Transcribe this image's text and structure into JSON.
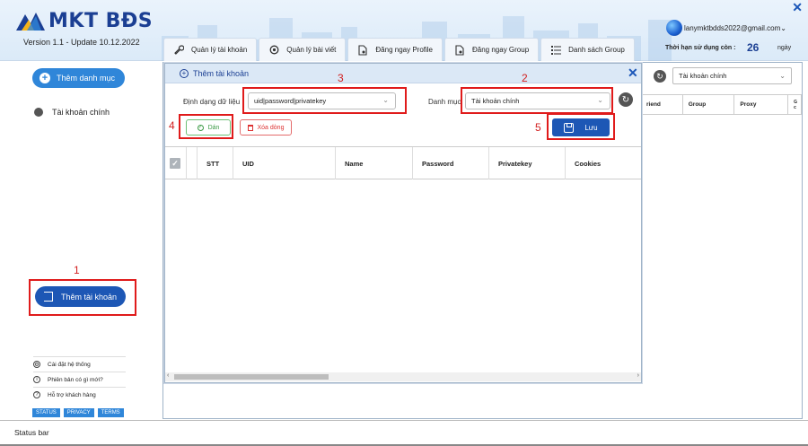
{
  "app": {
    "logo_text": "MKT BĐS",
    "version": "Version 1.1 - Update 10.12.2022",
    "close_symbol": "✕"
  },
  "user": {
    "email": "lanymktbdds2022@gmail.com",
    "remaining_label": "Thời hạn sử dụng còn :",
    "remaining_days": "26",
    "remaining_unit": "ngày"
  },
  "tabs": [
    {
      "label": "Quản lý tài khoản",
      "icon": "wrench-icon"
    },
    {
      "label": "Quản lý bài viết",
      "icon": "gear-eye-icon"
    },
    {
      "label": "Đăng ngay Profile",
      "icon": "document-icon"
    },
    {
      "label": "Đăng ngay Group",
      "icon": "document-icon"
    },
    {
      "label": "Danh sách Group",
      "icon": "list-icon"
    }
  ],
  "sidebar": {
    "add_category": "Thêm danh mục",
    "account_item": "Tài khoản chính",
    "add_account": "Thêm tài khoản",
    "links": [
      {
        "label": "Cài đặt hệ thống",
        "icon": "gear-icon"
      },
      {
        "label": "Phiên bản có gì mới?",
        "icon": "info-icon"
      },
      {
        "label": "Hỗ trợ khách hàng",
        "icon": "question-icon"
      }
    ],
    "badges": [
      "STATUS",
      "PRIVACY",
      "TERMS"
    ]
  },
  "main": {
    "category_select": "Tài khoản chính",
    "columns_visible": [
      "riend",
      "Group",
      "Proxy",
      "G c"
    ]
  },
  "dialog": {
    "title": "Thêm tài khoản",
    "format_label": "Định dạng dữ liệu",
    "format_value": "uid|password|privatekey",
    "category_label": "Danh mục",
    "category_value": "Tài khoản chính",
    "paste_label": "Dán",
    "delete_label": "Xóa dòng",
    "save_label": "Lưu",
    "columns": [
      "STT",
      "UID",
      "Name",
      "Password",
      "Privatekey",
      "Cookies"
    ]
  },
  "annotations": {
    "n1": "1",
    "n2": "2",
    "n3": "3",
    "n4": "4",
    "n5": "5"
  },
  "statusbar": {
    "text": "Status bar"
  },
  "colors": {
    "brand": "#1b3f93",
    "accent": "#2f86d9",
    "primary_button": "#1d57b5",
    "annotation": "#e01b1b"
  }
}
